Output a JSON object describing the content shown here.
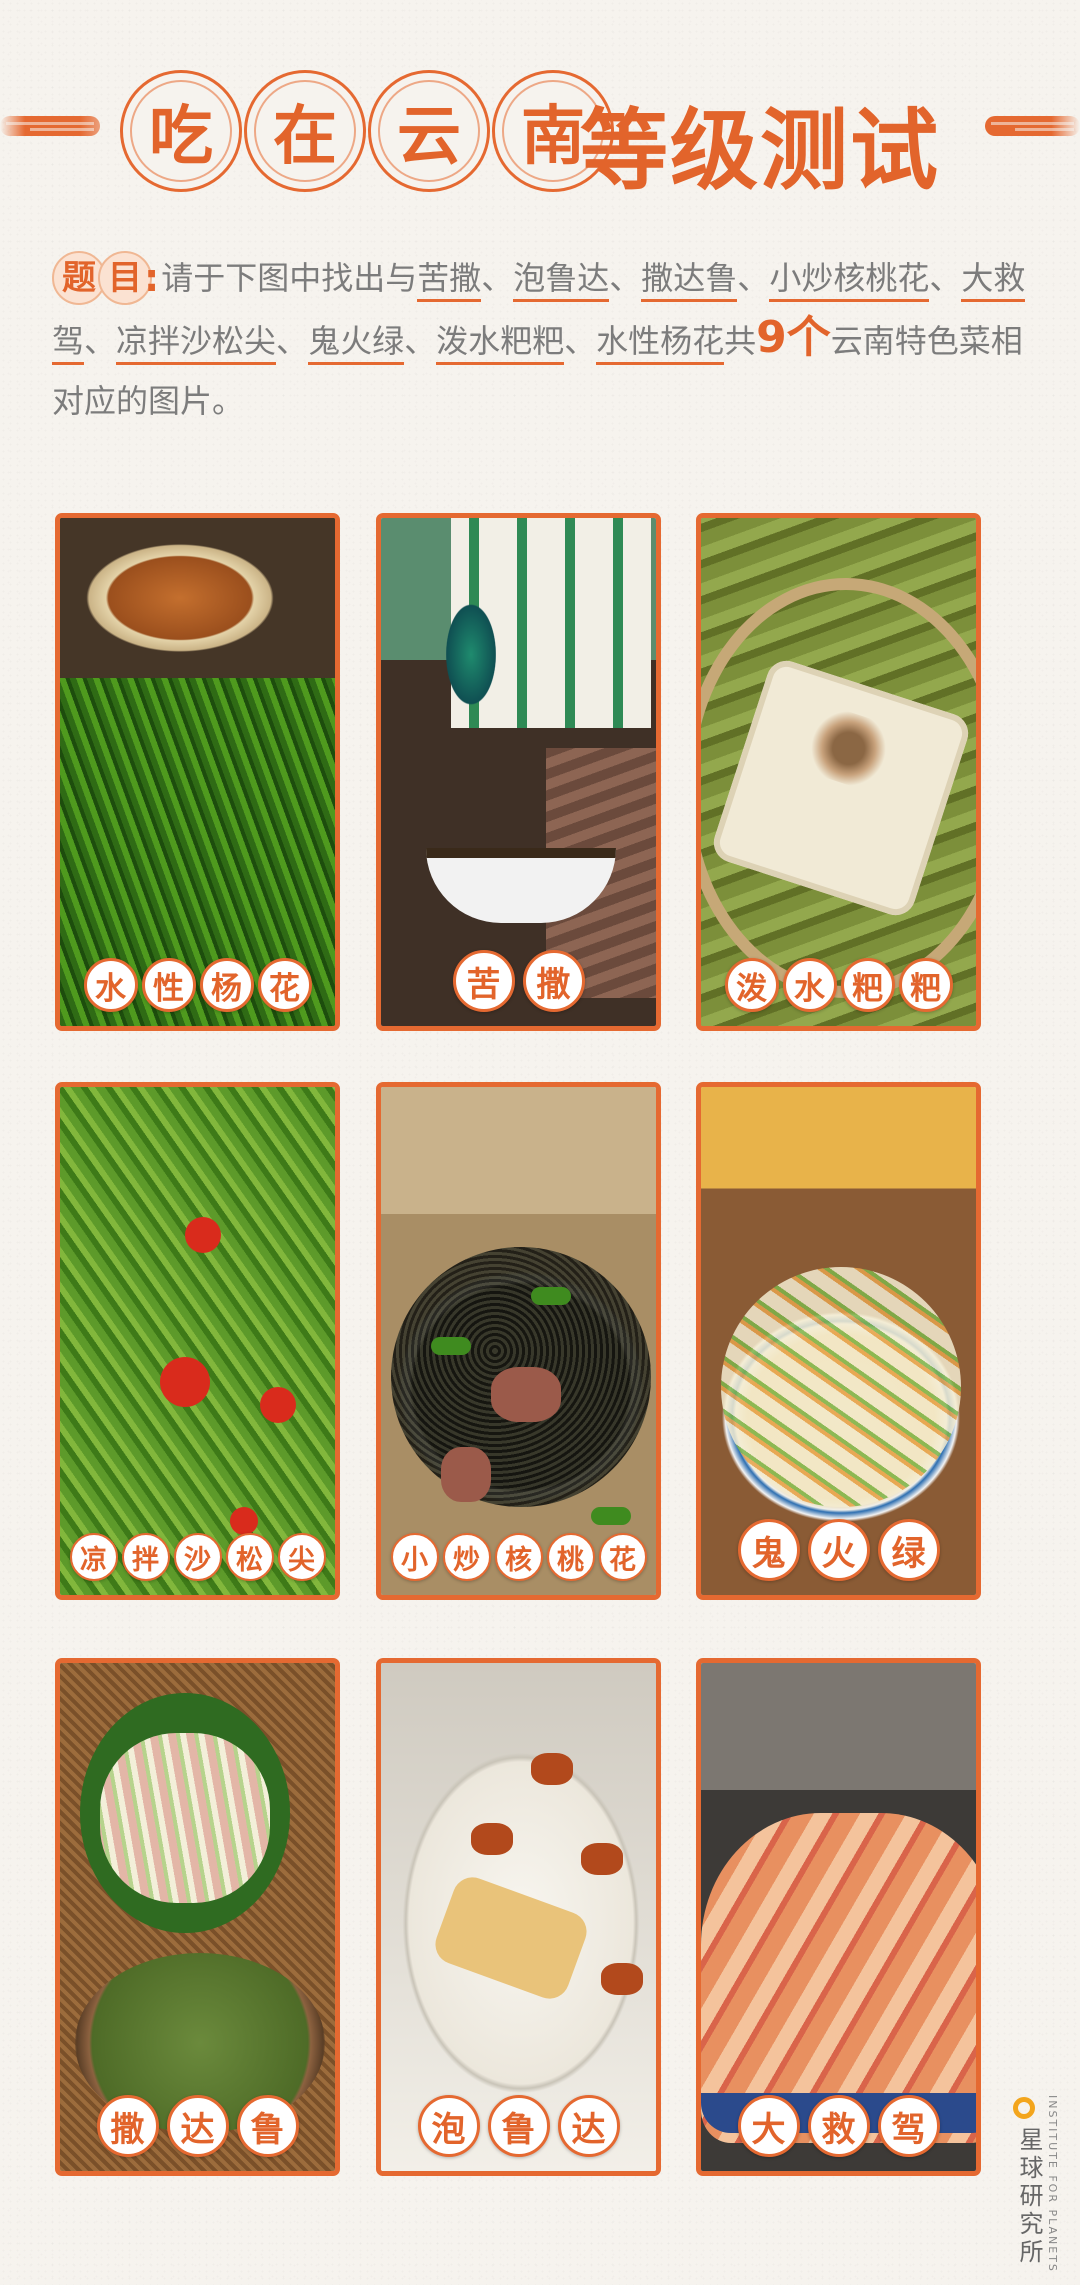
{
  "header": {
    "circle_chars": [
      "吃",
      "在",
      "云",
      "南"
    ],
    "rest": "等级测试"
  },
  "question": {
    "tag_chars": [
      "题",
      "目"
    ],
    "tag_colon": ":",
    "seg1": "请于下图中找出与",
    "items": [
      "苦撒",
      "泡鲁达",
      "撒达鲁",
      "小炒核桃花",
      "大救驾",
      "凉拌沙松尖",
      "鬼火绿",
      "泼水粑粑",
      "水性杨花"
    ],
    "sep": "、",
    "seg_gong": "共",
    "count": "9个",
    "seg_end": "云南特色菜相对应的图片。"
  },
  "cards": [
    {
      "chars": [
        "水",
        "性",
        "杨",
        "花"
      ]
    },
    {
      "chars": [
        "苦",
        "撒"
      ]
    },
    {
      "chars": [
        "泼",
        "水",
        "粑",
        "粑"
      ]
    },
    {
      "chars": [
        "凉",
        "拌",
        "沙",
        "松",
        "尖"
      ]
    },
    {
      "chars": [
        "小",
        "炒",
        "核",
        "桃",
        "花"
      ]
    },
    {
      "chars": [
        "鬼",
        "火",
        "绿"
      ]
    },
    {
      "chars": [
        "撒",
        "达",
        "鲁"
      ]
    },
    {
      "chars": [
        "泡",
        "鲁",
        "达"
      ]
    },
    {
      "chars": [
        "大",
        "救",
        "驾"
      ]
    }
  ],
  "logo": {
    "name": "星球研究所",
    "english": "INSTITUTE FOR PLANETS"
  },
  "colors": {
    "accent": "#e56931",
    "background": "#f6f3ee",
    "body_text": "#7c7c7c",
    "logo_ring": "#f3a51c"
  }
}
